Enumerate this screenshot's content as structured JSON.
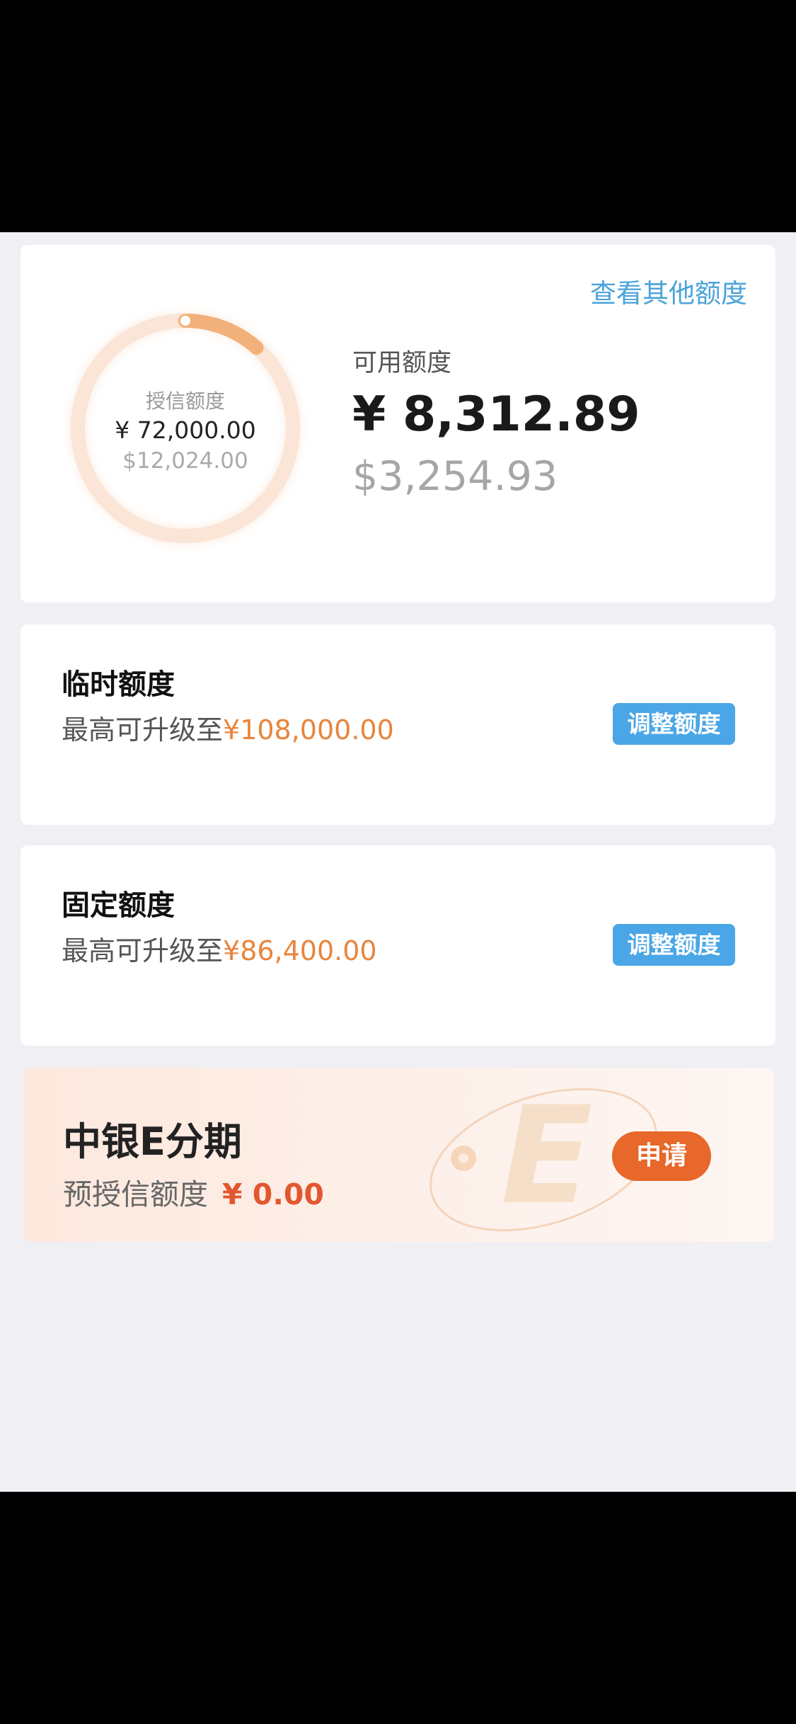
{
  "overview": {
    "other_limits_link": "查看其他额度",
    "credit_limit_label": "授信额度",
    "credit_limit_cny": "¥ 72,000.00",
    "credit_limit_usd": "$12,024.00",
    "available_label": "可用额度",
    "available_cny": "¥ 8,312.89",
    "available_usd": "$3,254.93",
    "ring_fill_fraction": 0.115
  },
  "temporary_limit": {
    "title": "临时额度",
    "desc_prefix": "最高可升级至",
    "amount": "¥108,000.00",
    "button_label": "调整额度"
  },
  "fixed_limit": {
    "title": "固定额度",
    "desc_prefix": "最高可升级至",
    "amount": "¥86,400.00",
    "button_label": "调整额度"
  },
  "installment": {
    "title": "中银E分期",
    "desc_prefix": "预授信额度",
    "amount": "¥ 0.00",
    "button_label": "申请",
    "watermark_letter": "E"
  },
  "colors": {
    "link_blue": "#4aa3d8",
    "button_blue": "#4aa6e6",
    "amount_orange": "#e8853c",
    "apply_orange": "#e8672a",
    "banner_amount_red": "#e2572f",
    "page_background": "#efeff4"
  }
}
